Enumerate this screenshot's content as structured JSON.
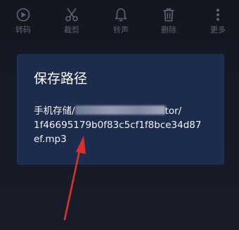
{
  "toolbar": {
    "items": [
      {
        "label": "转码",
        "icon": "convert-icon"
      },
      {
        "label": "裁剪",
        "icon": "scissors-icon"
      },
      {
        "label": "铃声",
        "icon": "bell-icon"
      },
      {
        "label": "删除",
        "icon": "trash-icon"
      },
      {
        "label": "更多",
        "icon": "more-icon"
      }
    ]
  },
  "dialog": {
    "title": "保存路径",
    "path_prefix": "手机存储/",
    "path_suffix": "tor/",
    "path_line2": "1f46695179b0f83c5cf1f8bce34d87",
    "path_line3": "ef.mp3"
  },
  "colors": {
    "background": "#161a26",
    "dialog": "#1d2c4c",
    "toolbar_text": "#5f6470",
    "arrow": "#d9322d"
  }
}
